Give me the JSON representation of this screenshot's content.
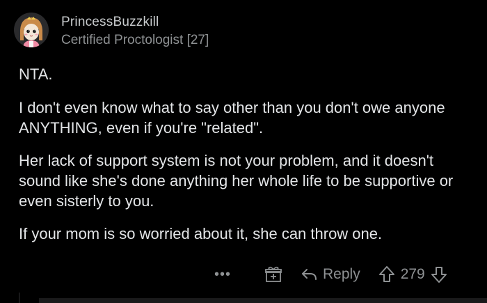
{
  "comment": {
    "author": "PrincessBuzzkill",
    "flair": "Certified Proctologist [27]",
    "paragraphs": [
      "NTA.",
      "I don't even know what to say other than you don't owe anyone ANYTHING, even if you're \"related\".",
      "Her lack of support system is not your problem, and it doesn't sound like she's done anything her whole life to be supportive or even sisterly to you.",
      "If your mom is so worried about it, she can throw one."
    ]
  },
  "actions": {
    "more": "•••",
    "reply_label": "Reply",
    "score": "279"
  },
  "colors": {
    "background": "#000000",
    "text": "#e3e5e7",
    "muted": "#8e9193"
  },
  "icons": [
    "avatar-image",
    "more-icon",
    "gift-icon",
    "reply-arrow-icon",
    "upvote-icon",
    "downvote-icon"
  ]
}
